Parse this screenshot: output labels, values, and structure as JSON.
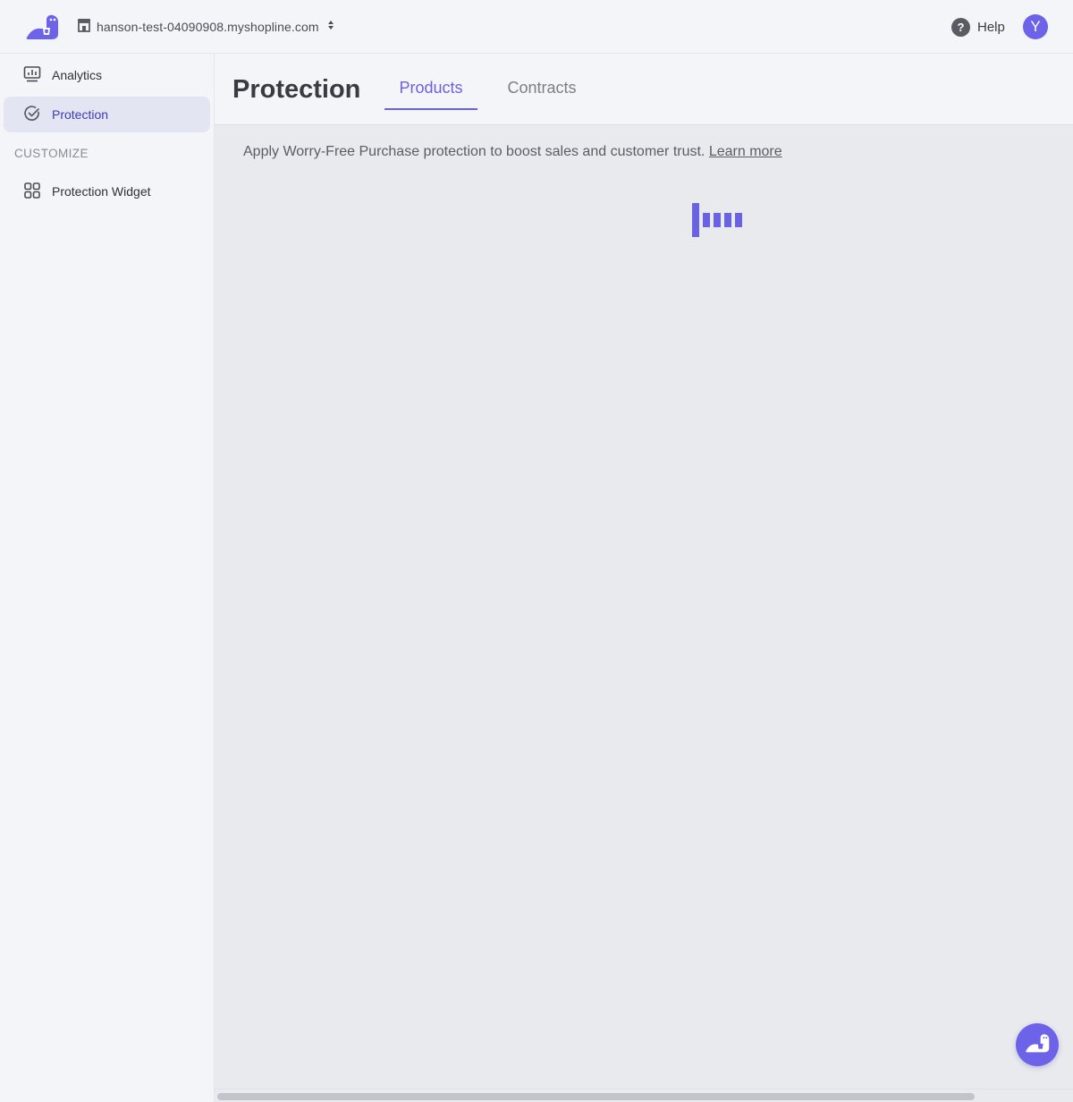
{
  "topbar": {
    "logo_icon": "dino-logo-icon",
    "store_icon": "storefront-icon",
    "store_name": "hanson-test-04090908.myshopline.com",
    "switch_icon": "up-down-caret-icon",
    "help_symbol": "?",
    "help_label": "Help",
    "avatar_initial": "Y"
  },
  "sidebar": {
    "items": [
      {
        "label": "Analytics",
        "icon": "analytics-monitor-icon",
        "active": false
      },
      {
        "label": "Protection",
        "icon": "shield-check-icon",
        "active": true
      }
    ],
    "section_label": "CUSTOMIZE",
    "customize_items": [
      {
        "label": "Protection Widget",
        "icon": "grid-icon",
        "active": false
      }
    ]
  },
  "main": {
    "title": "Protection",
    "tabs": [
      {
        "label": "Products",
        "active": true
      },
      {
        "label": "Contracts",
        "active": false
      }
    ],
    "description": "Apply Worry-Free Purchase protection to boost sales and customer trust.",
    "learn_more": "Learn more",
    "loading_icon": "loading-bars-icon"
  },
  "fab": {
    "icon": "dino-chat-icon"
  },
  "colors": {
    "accent": "#6c63e8",
    "active_nav_bg": "#e3e5f2",
    "active_nav_text": "#3e3bb5",
    "content_bg": "#e9eaee",
    "sidebar_bg": "#f4f5f9"
  }
}
